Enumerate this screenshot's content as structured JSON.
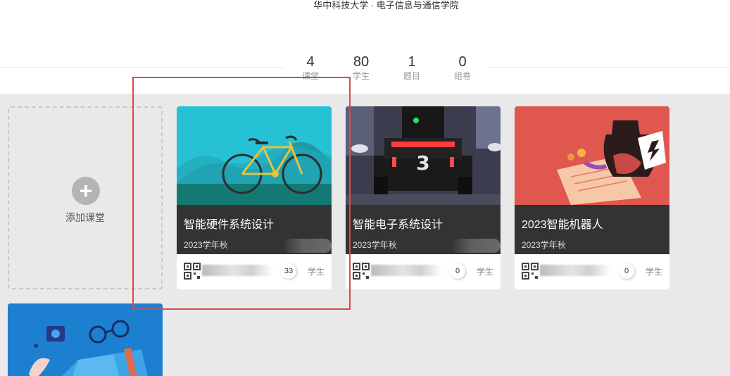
{
  "header": {
    "school": "华中科技大学 · 电子信息与通信学院",
    "stats": [
      {
        "num": "4",
        "label": "课堂"
      },
      {
        "num": "80",
        "label": "学生"
      },
      {
        "num": "1",
        "label": "题目"
      },
      {
        "num": "0",
        "label": "组卷"
      }
    ]
  },
  "add_card": {
    "icon": "plus-icon",
    "label": "添加课堂"
  },
  "courses": [
    {
      "title": "智能硬件系统设计",
      "term": "2023学年秋",
      "count": "33",
      "count_label": "学生",
      "cover": "bicycle-illustration"
    },
    {
      "title": "智能电子系统设计",
      "term": "2023学年秋",
      "count": "0",
      "count_label": "学生",
      "cover": "robot-car-photo"
    },
    {
      "title": "2023智能机器人",
      "term": "2023学年秋",
      "count": "0",
      "count_label": "学生",
      "cover": "vase-illustration"
    }
  ],
  "partial_card": {
    "cover": "desk-illustration"
  },
  "colors": {
    "highlight": "#e04545",
    "card_bar": "#333333",
    "bike_bg": "#27c1d6",
    "vase_bg": "#e0574f",
    "desk_bg": "#1c7fd0"
  }
}
